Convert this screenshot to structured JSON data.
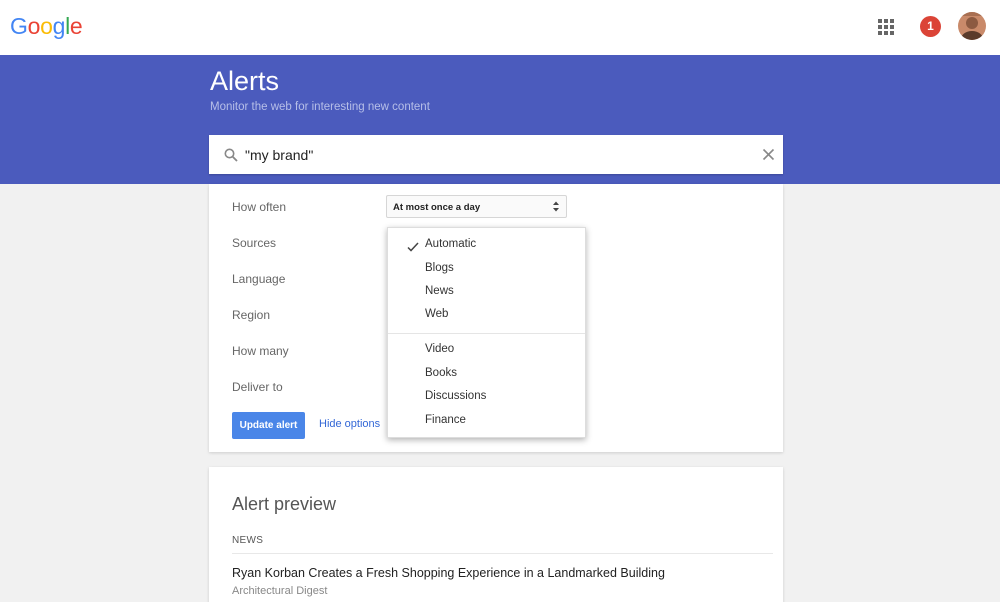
{
  "header": {
    "logo_letters": [
      {
        "ch": "G",
        "color": "#4285f4"
      },
      {
        "ch": "o",
        "color": "#ea4335"
      },
      {
        "ch": "o",
        "color": "#fbbc05"
      },
      {
        "ch": "g",
        "color": "#4285f4"
      },
      {
        "ch": "l",
        "color": "#34a853"
      },
      {
        "ch": "e",
        "color": "#ea4335"
      }
    ],
    "apps_icon": "apps-grid-icon",
    "notification_count": "1",
    "avatar_icon": "user-avatar"
  },
  "banner": {
    "title": "Alerts",
    "subtitle": "Monitor the web for interesting new content",
    "color": "#4b5bbd"
  },
  "search": {
    "value": "\"my brand\"",
    "search_icon": "search-icon",
    "clear_icon": "close-icon"
  },
  "options": {
    "labels": {
      "how_often": "How often",
      "sources": "Sources",
      "language": "Language",
      "region": "Region",
      "how_many": "How many",
      "deliver_to": "Deliver to"
    },
    "how_often_value": "At most once a day",
    "update_button": "Update alert",
    "hide_options": "Hide options",
    "accent_color": "#4a86e8"
  },
  "sources_dropdown": {
    "selected": "Automatic",
    "items": [
      "Automatic",
      "Blogs",
      "News",
      "Web",
      "Video",
      "Books",
      "Discussions",
      "Finance"
    ]
  },
  "preview": {
    "title": "Alert preview",
    "section": "NEWS",
    "article_title": "Ryan Korban Creates a Fresh Shopping Experience in a Landmarked Building",
    "article_source": "Architectural Digest"
  }
}
